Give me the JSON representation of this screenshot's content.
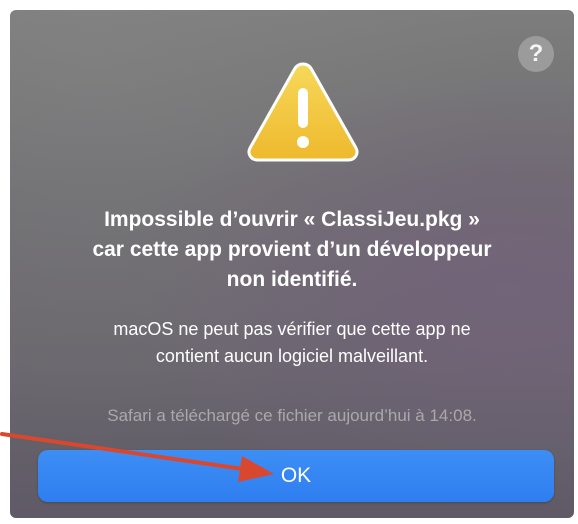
{
  "dialog": {
    "help_glyph": "?",
    "icon": "warning-triangle-icon",
    "title_lines": [
      "Impossible d’ouvrir « ClassiJeu.pkg »",
      "car cette app provient d’un développeur",
      "non identifié."
    ],
    "message_lines": [
      "macOS ne peut pas vérifier que cette app ne",
      "contient aucun logiciel malveillant."
    ],
    "download_note": "Safari a téléchargé ce fichier aujourd’hui à 14:08.",
    "ok_label": "OK"
  },
  "colors": {
    "accent": "#3488f3",
    "warning_fill": "#f3c53b",
    "annotation_arrow": "#d9482e"
  }
}
